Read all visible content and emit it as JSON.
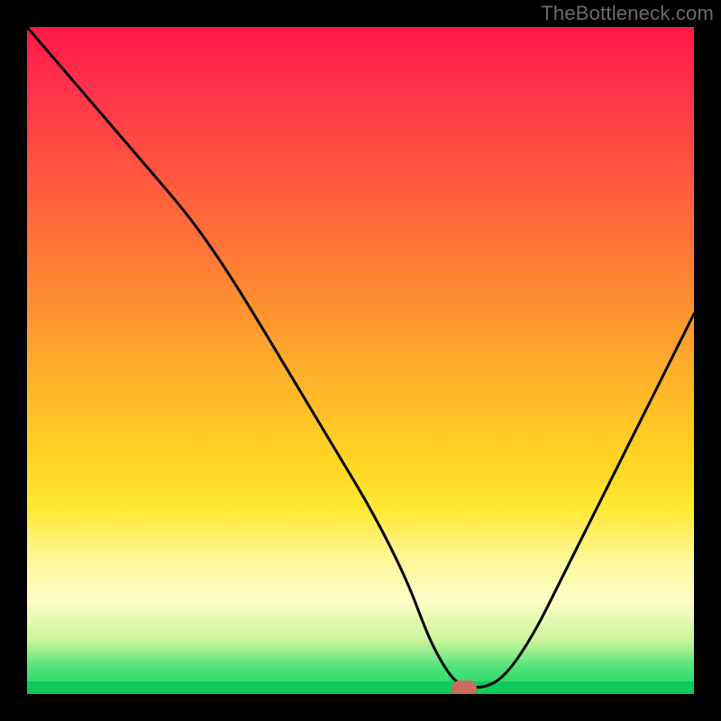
{
  "watermark": "TheBottleneck.com",
  "chart_data": {
    "type": "line",
    "title": "",
    "xlabel": "",
    "ylabel": "",
    "xlim": [
      0,
      100
    ],
    "ylim": [
      0,
      100
    ],
    "grid": false,
    "x": [
      0,
      6,
      12,
      18,
      24,
      29,
      34,
      40,
      46,
      52,
      57,
      60,
      62,
      64,
      66,
      69,
      72,
      76,
      80,
      84,
      88,
      92,
      96,
      100
    ],
    "values": [
      100,
      93,
      86,
      79,
      72,
      65,
      57,
      47,
      37,
      27,
      17,
      9,
      5,
      2,
      1,
      1,
      3,
      9,
      17,
      25,
      33,
      41,
      49,
      57
    ],
    "minimum_marker": {
      "x": 65.5,
      "y": 0.8
    },
    "background_gradient_stops": [
      {
        "pct": 0,
        "color": "#ff1846"
      },
      {
        "pct": 22,
        "color": "#ff5640"
      },
      {
        "pct": 52,
        "color": "#ffb02a"
      },
      {
        "pct": 72,
        "color": "#ffe832"
      },
      {
        "pct": 86,
        "color": "#fffcc8"
      },
      {
        "pct": 96,
        "color": "#4fe37a"
      },
      {
        "pct": 100,
        "color": "#1fd466"
      }
    ]
  }
}
